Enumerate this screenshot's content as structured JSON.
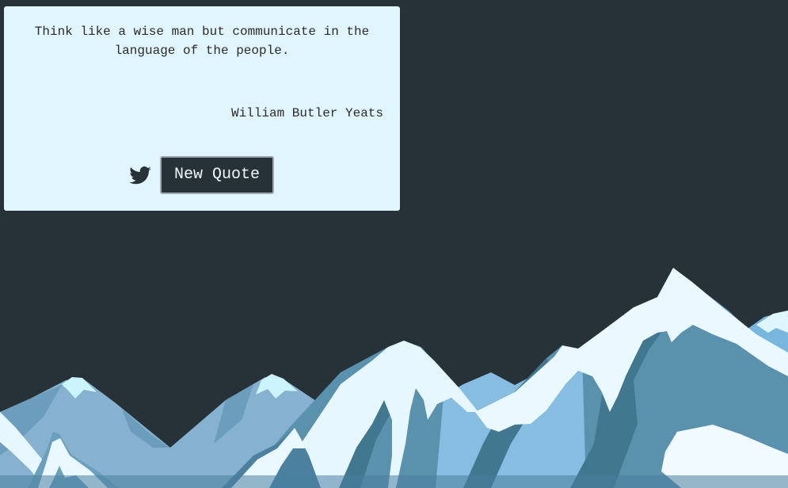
{
  "quote": {
    "text": "Think like a wise man but communicate in the language of the people.",
    "author": "William Butler Yeats"
  },
  "actions": {
    "tweet_icon": "twitter-bird-icon",
    "new_quote_label": "New Quote"
  },
  "colors": {
    "background": "#263238",
    "card": "#e1f5fe",
    "button": "#263238",
    "snow": "#eaf8ff",
    "mountain_light": "#7fb4d6",
    "mountain_mid": "#5b91ad",
    "mountain_dark": "#477f9a"
  }
}
